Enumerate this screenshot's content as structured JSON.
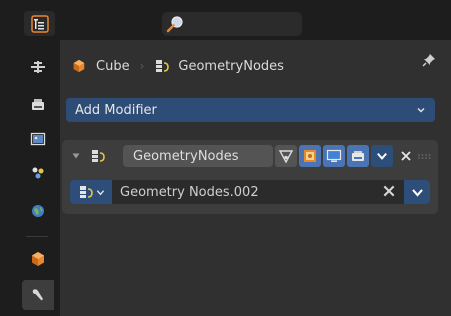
{
  "breadcrumb": {
    "object": "Cube",
    "modifier": "GeometryNodes"
  },
  "add_modifier": {
    "label": "Add Modifier"
  },
  "modifier": {
    "name": "GeometryNodes",
    "node_group": "Geometry Nodes.002"
  },
  "colors": {
    "accent": "#2d4d77",
    "panel": "#303030",
    "orange": "#e8872c",
    "toggle_active": "#4a74b4"
  },
  "icons": {
    "editor_type": "properties-editor-icon",
    "search": "search-icon",
    "pin": "pin-icon",
    "modifier": "geometry-nodes-icon",
    "remove": "close-icon"
  },
  "tabs": [
    "tool",
    "render",
    "output",
    "view-layer",
    "scene",
    "world",
    "object",
    "modifiers"
  ]
}
